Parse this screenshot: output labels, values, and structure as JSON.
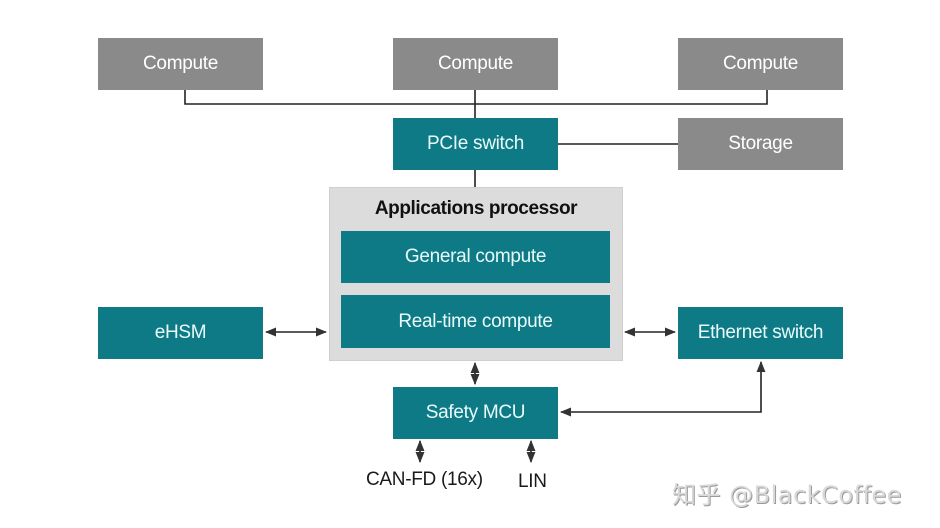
{
  "diagram": {
    "compute_nodes": [
      {
        "label": "Compute"
      },
      {
        "label": "Compute"
      },
      {
        "label": "Compute"
      }
    ],
    "pcie_switch": {
      "label": "PCIe switch"
    },
    "storage": {
      "label": "Storage"
    },
    "applications_processor": {
      "title": "Applications processor",
      "blocks": [
        {
          "label": "General compute"
        },
        {
          "label": "Real-time compute"
        }
      ]
    },
    "ehsm": {
      "label": "eHSM"
    },
    "ethernet_switch": {
      "label": "Ethernet switch"
    },
    "safety_mcu": {
      "label": "Safety MCU"
    },
    "interfaces": [
      {
        "label": "CAN-FD (16x)"
      },
      {
        "label": "LIN"
      }
    ],
    "connections": [
      {
        "from": "Compute",
        "to": "PCIe switch",
        "type": "bus"
      },
      {
        "from": "PCIe switch",
        "to": "Storage",
        "type": "line"
      },
      {
        "from": "PCIe switch",
        "to": "Applications processor",
        "type": "line"
      },
      {
        "from": "eHSM",
        "to": "Applications processor",
        "type": "bidirectional"
      },
      {
        "from": "Applications processor",
        "to": "Ethernet switch",
        "type": "bidirectional"
      },
      {
        "from": "Applications processor",
        "to": "Safety MCU",
        "type": "bidirectional"
      },
      {
        "from": "Ethernet switch",
        "to": "Safety MCU",
        "type": "bidirectional"
      },
      {
        "from": "Safety MCU",
        "to": "CAN-FD (16x)",
        "type": "bidirectional"
      },
      {
        "from": "Safety MCU",
        "to": "LIN",
        "type": "bidirectional"
      }
    ],
    "colors": {
      "teal": "#0e7a86",
      "gray": "#8a8a8a",
      "container": "#dcdcdc"
    }
  },
  "watermark": "知乎 @BlackCoffee"
}
